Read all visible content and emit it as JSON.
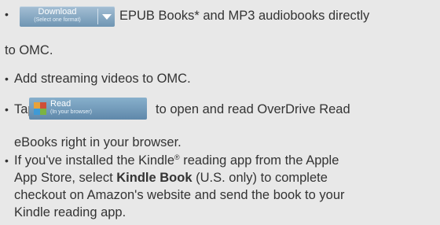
{
  "items": [
    {
      "bullet": "•",
      "button": {
        "label": "Download",
        "sublabel": "(Select one format)"
      },
      "text_part1": "EPUB Books* and MP3 audiobooks directly",
      "text_part2": "to OMC."
    },
    {
      "bullet": "•",
      "text": "Add streaming videos to OMC."
    },
    {
      "bullet": "•",
      "prefix": "Tap",
      "button": {
        "label": "Read",
        "sublabel": "(In your browser)"
      },
      "text_part1": "to open and read OverDrive Read",
      "text_part2": "eBooks right in your browser."
    },
    {
      "bullet": "•",
      "line1": "If you've installed the Kindle",
      "line1_sup": "®",
      "line1_rest": " reading app from the Apple",
      "line2_pre": "App Store, select ",
      "line2_bold": "Kindle Book",
      "line2_post": " (U.S. only) to complete",
      "line3": "checkout on Amazon's website and send the book to your",
      "line4": "Kindle reading app."
    }
  ],
  "colors": {
    "background": "#e8e8e8",
    "text": "#333333",
    "button": "#6f95b3"
  },
  "icons": {
    "read": "read-book-icon",
    "dropdown": "caret-down-icon"
  }
}
